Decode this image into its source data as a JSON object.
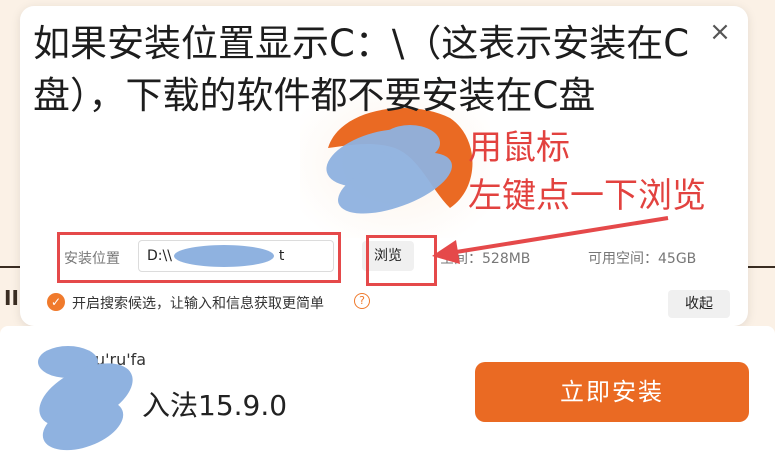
{
  "background": {
    "fragment": "II"
  },
  "dialog": {
    "close_glyph": "×",
    "path_label": "安装位置",
    "path_value": "D:\\\\",
    "path_value_suffix": "t",
    "browse_label": "浏览",
    "space_required": "空间：528MB",
    "space_available": "可用空间：45GB",
    "option_label": "开启搜索候选，让输入和信息获取更简单",
    "help_glyph": "?",
    "collapse_label": "收起"
  },
  "bottom": {
    "pinyin_fragment": "u'shu'ru'fa",
    "version_fragment": "入法15.9.0",
    "install_label": "立即安装"
  },
  "annotation": {
    "title": "如果安装位置显示C：\\（这表示安装在C盘），下载的软件都不要安装在C盘",
    "side_line1": "用鼠标",
    "side_line2": "左键点一下浏览"
  },
  "colors": {
    "accent": "#ea6a23",
    "annotation_red": "#e2423f",
    "blur_blue": "#8fb2e0"
  }
}
